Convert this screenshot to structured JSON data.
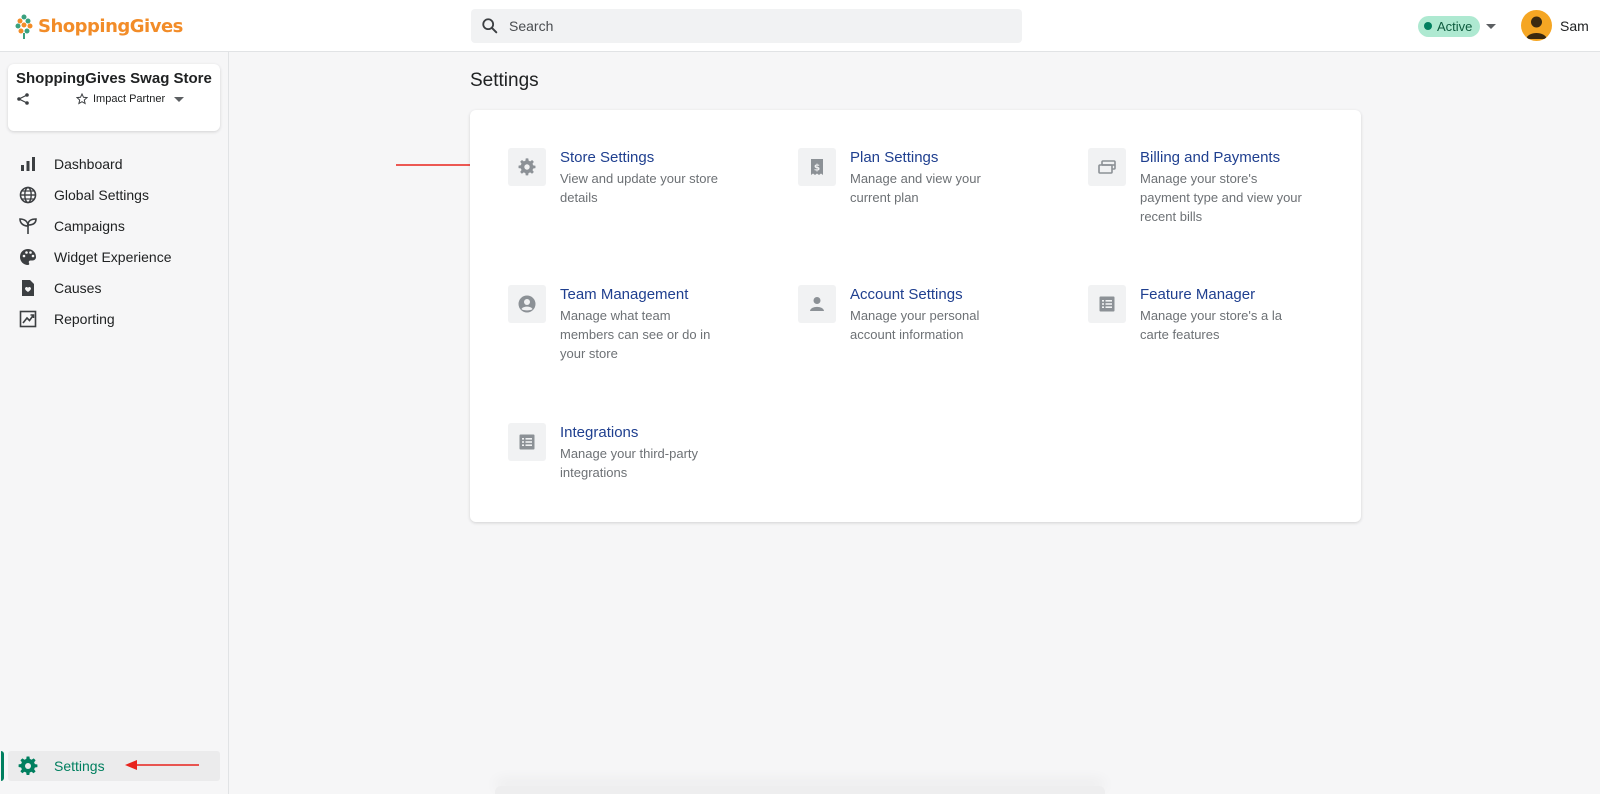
{
  "brand": {
    "name": "ShoppingGives"
  },
  "search": {
    "placeholder": "Search"
  },
  "status": {
    "label": "Active"
  },
  "user": {
    "name": "Sam"
  },
  "store": {
    "name": "ShoppingGives Swag Store",
    "partner_label": "Impact Partner"
  },
  "nav": {
    "items": [
      {
        "label": "Dashboard",
        "icon": "bar-chart-icon"
      },
      {
        "label": "Global Settings",
        "icon": "globe-icon"
      },
      {
        "label": "Campaigns",
        "icon": "sprout-icon"
      },
      {
        "label": "Widget Experience",
        "icon": "palette-icon"
      },
      {
        "label": "Causes",
        "icon": "heart-doc-icon"
      },
      {
        "label": "Reporting",
        "icon": "trend-report-icon"
      }
    ],
    "settings_label": "Settings"
  },
  "page": {
    "title": "Settings"
  },
  "tiles": [
    {
      "title": "Store Settings",
      "desc_lines": [
        "View and update your store",
        "details"
      ],
      "icon": "gear-icon"
    },
    {
      "title": "Plan Settings",
      "desc_lines": [
        "Manage and view your",
        "current plan"
      ],
      "icon": "receipt-dollar-icon"
    },
    {
      "title": "Billing and Payments",
      "desc_lines": [
        "Manage your store's",
        "payment type and view your",
        "recent bills"
      ],
      "icon": "credit-card-icon"
    },
    {
      "title": "Team Management",
      "desc_lines": [
        "Manage what team",
        "members can see or do in",
        "your store"
      ],
      "icon": "person-circle-icon"
    },
    {
      "title": "Account Settings",
      "desc_lines": [
        "Manage your personal",
        "account information"
      ],
      "icon": "person-icon"
    },
    {
      "title": "Feature Manager",
      "desc_lines": [
        "Manage your store's a la",
        "carte features"
      ],
      "icon": "list-icon"
    },
    {
      "title": "Integrations",
      "desc_lines": [
        "Manage your third-party",
        "integrations"
      ],
      "icon": "list-icon"
    }
  ],
  "colors": {
    "accent": "#007f5f",
    "link": "#1f3f8f",
    "brand": "#f28c28",
    "annotation_arrow": "#e8231d"
  }
}
